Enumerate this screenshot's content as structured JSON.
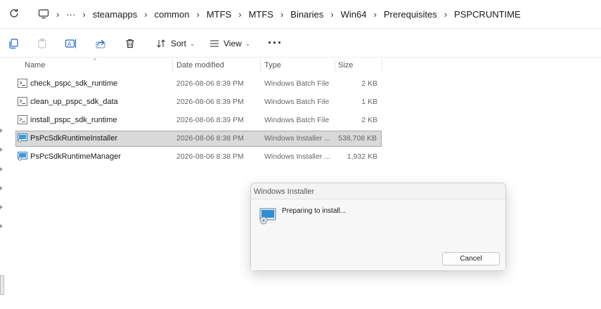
{
  "breadcrumb": {
    "overflow": "···",
    "segments": [
      "steamapps",
      "common",
      "MTFS",
      "MTFS",
      "Binaries",
      "Win64",
      "Prerequisites",
      "PSPCRUNTIME"
    ]
  },
  "toolbar": {
    "sort_label": "Sort",
    "view_label": "View",
    "more_label": "···"
  },
  "columns": {
    "name": "Name",
    "date": "Date modified",
    "type": "Type",
    "size": "Size"
  },
  "files": [
    {
      "name": "check_pspc_sdk_runtime",
      "date": "2026-08-06 8:39 PM",
      "type": "Windows Batch File",
      "size": "2 KB",
      "kind": "batch"
    },
    {
      "name": "clean_up_pspc_sdk_data",
      "date": "2026-08-06 8:39 PM",
      "type": "Windows Batch File",
      "size": "1 KB",
      "kind": "batch"
    },
    {
      "name": "install_pspc_sdk_runtime",
      "date": "2026-08-06 8:39 PM",
      "type": "Windows Batch File",
      "size": "2 KB",
      "kind": "batch"
    },
    {
      "name": "PsPcSdkRuntimeInstaller",
      "date": "2026-08-06 8:38 PM",
      "type": "Windows Installer ...",
      "size": "538,708 KB",
      "kind": "installer",
      "selected": true
    },
    {
      "name": "PsPcSdkRuntimeManager",
      "date": "2026-08-06 8:38 PM",
      "type": "Windows Installer ...",
      "size": "1,932 KB",
      "kind": "installer"
    }
  ],
  "dialog": {
    "title": "Windows Installer",
    "message": "Preparing to install...",
    "cancel_label": "Cancel"
  }
}
